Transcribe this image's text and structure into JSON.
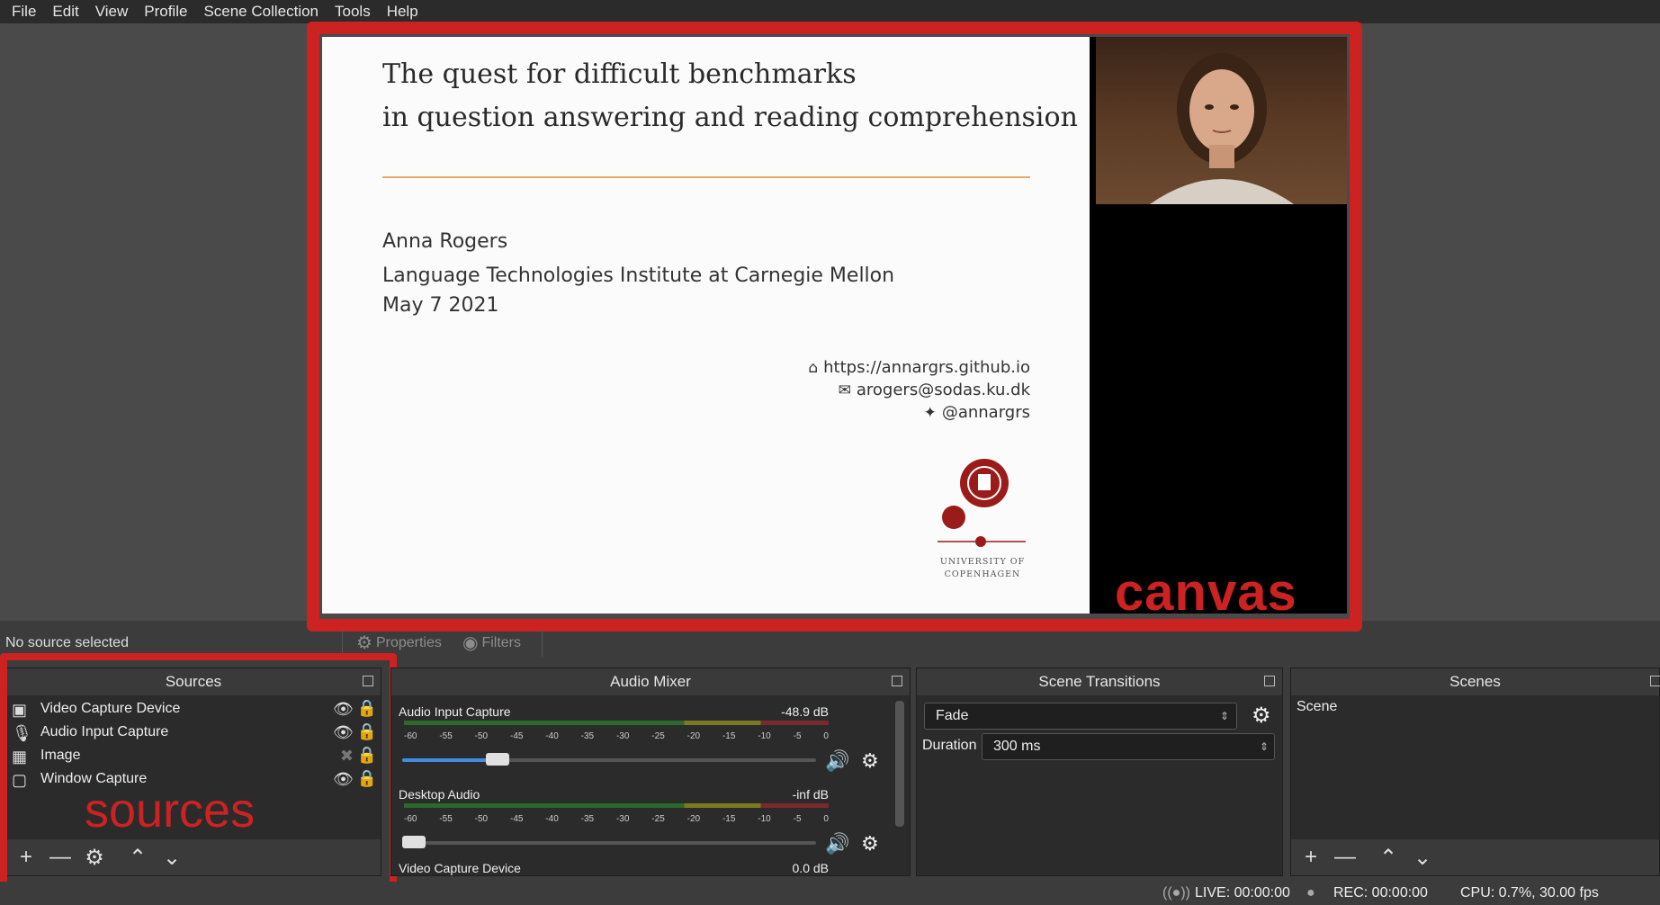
{
  "menu": [
    "File",
    "Edit",
    "View",
    "Profile",
    "Scene Collection",
    "Tools",
    "Help"
  ],
  "slide": {
    "title_line1": "The quest for difficult benchmarks",
    "title_line2": "in question answering and reading comprehension",
    "author": "Anna Rogers",
    "affiliation": "Language Technologies Institute at Carnegie Mellon",
    "date": "May 7 2021",
    "website": "https://annargrs.github.io",
    "email": "arogers@sodas.ku.dk",
    "twitter": "@annargrs",
    "logo_text_1": "UNIVERSITY OF",
    "logo_text_2": "COPENHAGEN"
  },
  "annotations": {
    "canvas": "canvas",
    "sources": "sources"
  },
  "toolbar": {
    "no_source": "No source selected",
    "properties": "Properties",
    "filters": "Filters"
  },
  "sources": {
    "title": "Sources",
    "items": [
      {
        "label": "Video Capture Device",
        "icon": "camera-icon",
        "visible": true
      },
      {
        "label": "Audio Input Capture",
        "icon": "microphone-icon",
        "visible": true
      },
      {
        "label": "Image",
        "icon": "image-icon",
        "visible": false
      },
      {
        "label": "Window Capture",
        "icon": "window-icon",
        "visible": true
      }
    ]
  },
  "mixer": {
    "title": "Audio Mixer",
    "channels": [
      {
        "name": "Audio Input Capture",
        "db": "-48.9 dB",
        "volume": 0.2
      },
      {
        "name": "Desktop Audio",
        "db": "-inf dB",
        "volume": 0.0
      },
      {
        "name": "Video Capture Device",
        "db": "0.0 dB"
      }
    ],
    "ticks": [
      "-60",
      "-55",
      "-50",
      "-45",
      "-40",
      "-35",
      "-30",
      "-25",
      "-20",
      "-15",
      "-10",
      "-5",
      "0"
    ]
  },
  "transitions": {
    "title": "Scene Transitions",
    "selected": "Fade",
    "duration_label": "Duration",
    "duration_value": "300 ms"
  },
  "scenes": {
    "title": "Scenes",
    "items": [
      "Scene"
    ]
  },
  "status": {
    "live": "LIVE: 00:00:00",
    "rec": "REC: 00:00:00",
    "cpu": "CPU: 0.7%, 30.00 fps"
  },
  "colors": {
    "accent_red": "#cc2222",
    "slider_blue": "#3f8fe0",
    "rule_orange": "#e8a86a"
  }
}
